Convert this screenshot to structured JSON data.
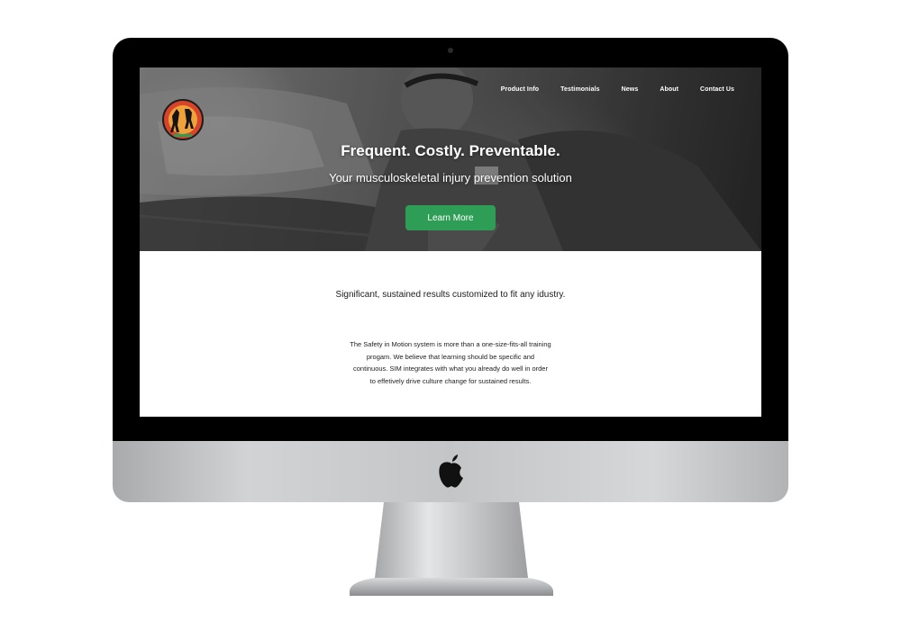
{
  "device": {
    "type": "desktop monitor mockup",
    "brand_icon": "apple-logo-icon"
  },
  "site": {
    "logo_icon": "safety-in-motion-logo-icon",
    "nav": [
      {
        "label": "Product Info"
      },
      {
        "label": "Testimonials"
      },
      {
        "label": "News"
      },
      {
        "label": "About"
      },
      {
        "label": "Contact Us"
      }
    ],
    "hero": {
      "title": "Frequent. Costly. Preventable.",
      "subtitle": "Your musculoskeletal injury prevention solution",
      "cta_label": "Learn More"
    },
    "content": {
      "headline": "Significant, sustained results customized to fit any idustry.",
      "body_lines": [
        "The Safety in Motion system is more than a one-size-fits-all training",
        "progam. We believe that learning should be specific and",
        "continuous. SIM integrates with what you already do well in order",
        "to effetively drive culture change for sustained results."
      ]
    }
  },
  "colors": {
    "cta_green": "#2e9e57",
    "bezel": "#000000",
    "chin_silver": "#c4c5c7"
  }
}
